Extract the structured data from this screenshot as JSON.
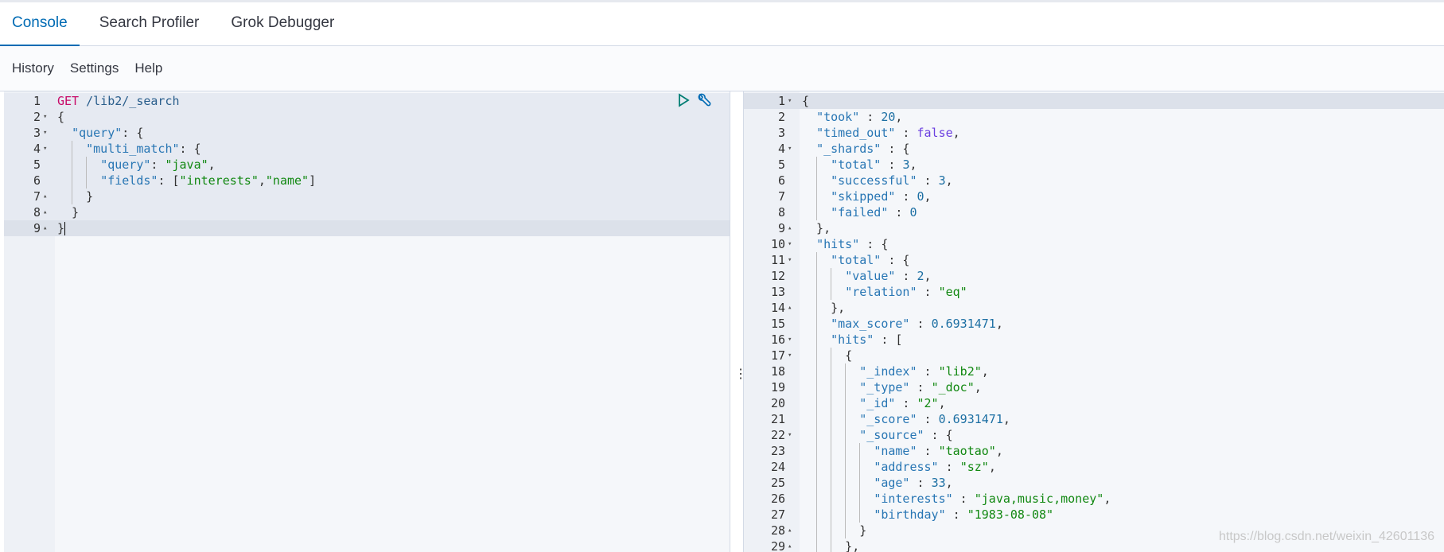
{
  "tabs": [
    {
      "label": "Console",
      "active": true
    },
    {
      "label": "Search Profiler"
    },
    {
      "label": "Grok Debugger"
    }
  ],
  "menu": [
    "History",
    "Settings",
    "Help"
  ],
  "colors": {
    "accent": "#006bb4",
    "key": "#2876b4",
    "string": "#118811",
    "number": "#1c6fa3",
    "boolean": "#6b3fe0",
    "method": "#c80a68"
  },
  "actions": {
    "run": "play-icon",
    "settings": "wrench-icon"
  },
  "divider_icon": "⋮",
  "watermark": "https://blog.csdn.net/weixin_42601136",
  "request": [
    {
      "n": "1",
      "f": "",
      "t": [
        [
          "m",
          "GET"
        ],
        [
          "p",
          " "
        ],
        [
          "url",
          "/lib2/_search"
        ]
      ]
    },
    {
      "n": "2",
      "f": "▾",
      "t": [
        [
          "p",
          "{"
        ]
      ]
    },
    {
      "n": "3",
      "f": "▾",
      "t": [
        [
          "p",
          "  "
        ],
        [
          "key",
          "\"query\""
        ],
        [
          "p",
          ": {"
        ]
      ]
    },
    {
      "n": "4",
      "f": "▾",
      "t": [
        [
          "p",
          "    "
        ],
        [
          "key",
          "\"multi_match\""
        ],
        [
          "p",
          ": {"
        ]
      ]
    },
    {
      "n": "5",
      "f": "",
      "t": [
        [
          "p",
          "      "
        ],
        [
          "key",
          "\"query\""
        ],
        [
          "p",
          ": "
        ],
        [
          "str",
          "\"java\""
        ],
        [
          "p",
          ","
        ]
      ]
    },
    {
      "n": "6",
      "f": "",
      "t": [
        [
          "p",
          "      "
        ],
        [
          "key",
          "\"fields\""
        ],
        [
          "p",
          ": ["
        ],
        [
          "str",
          "\"interests\""
        ],
        [
          "p",
          ","
        ],
        [
          "str",
          "\"name\""
        ],
        [
          "p",
          "]"
        ]
      ]
    },
    {
      "n": "7",
      "f": "▴",
      "t": [
        [
          "p",
          "    }"
        ]
      ]
    },
    {
      "n": "8",
      "f": "▴",
      "t": [
        [
          "p",
          "  }"
        ]
      ]
    },
    {
      "n": "9",
      "f": "▴",
      "t": [
        [
          "p",
          "}"
        ]
      ]
    }
  ],
  "response": [
    {
      "n": "1",
      "f": "▾",
      "t": [
        [
          "p",
          "{"
        ]
      ]
    },
    {
      "n": "2",
      "f": "",
      "t": [
        [
          "p",
          "  "
        ],
        [
          "key",
          "\"took\""
        ],
        [
          "p",
          " : "
        ],
        [
          "num",
          "20"
        ],
        [
          "p",
          ","
        ]
      ]
    },
    {
      "n": "3",
      "f": "",
      "t": [
        [
          "p",
          "  "
        ],
        [
          "key",
          "\"timed_out\""
        ],
        [
          "p",
          " : "
        ],
        [
          "bool",
          "false"
        ],
        [
          "p",
          ","
        ]
      ]
    },
    {
      "n": "4",
      "f": "▾",
      "t": [
        [
          "p",
          "  "
        ],
        [
          "key",
          "\"_shards\""
        ],
        [
          "p",
          " : {"
        ]
      ]
    },
    {
      "n": "5",
      "f": "",
      "t": [
        [
          "p",
          "    "
        ],
        [
          "key",
          "\"total\""
        ],
        [
          "p",
          " : "
        ],
        [
          "num",
          "3"
        ],
        [
          "p",
          ","
        ]
      ]
    },
    {
      "n": "6",
      "f": "",
      "t": [
        [
          "p",
          "    "
        ],
        [
          "key",
          "\"successful\""
        ],
        [
          "p",
          " : "
        ],
        [
          "num",
          "3"
        ],
        [
          "p",
          ","
        ]
      ]
    },
    {
      "n": "7",
      "f": "",
      "t": [
        [
          "p",
          "    "
        ],
        [
          "key",
          "\"skipped\""
        ],
        [
          "p",
          " : "
        ],
        [
          "num",
          "0"
        ],
        [
          "p",
          ","
        ]
      ]
    },
    {
      "n": "8",
      "f": "",
      "t": [
        [
          "p",
          "    "
        ],
        [
          "key",
          "\"failed\""
        ],
        [
          "p",
          " : "
        ],
        [
          "num",
          "0"
        ]
      ]
    },
    {
      "n": "9",
      "f": "▴",
      "t": [
        [
          "p",
          "  },"
        ]
      ]
    },
    {
      "n": "10",
      "f": "▾",
      "t": [
        [
          "p",
          "  "
        ],
        [
          "key",
          "\"hits\""
        ],
        [
          "p",
          " : {"
        ]
      ]
    },
    {
      "n": "11",
      "f": "▾",
      "t": [
        [
          "p",
          "    "
        ],
        [
          "key",
          "\"total\""
        ],
        [
          "p",
          " : {"
        ]
      ]
    },
    {
      "n": "12",
      "f": "",
      "t": [
        [
          "p",
          "      "
        ],
        [
          "key",
          "\"value\""
        ],
        [
          "p",
          " : "
        ],
        [
          "num",
          "2"
        ],
        [
          "p",
          ","
        ]
      ]
    },
    {
      "n": "13",
      "f": "",
      "t": [
        [
          "p",
          "      "
        ],
        [
          "key",
          "\"relation\""
        ],
        [
          "p",
          " : "
        ],
        [
          "str",
          "\"eq\""
        ]
      ]
    },
    {
      "n": "14",
      "f": "▴",
      "t": [
        [
          "p",
          "    },"
        ]
      ]
    },
    {
      "n": "15",
      "f": "",
      "t": [
        [
          "p",
          "    "
        ],
        [
          "key",
          "\"max_score\""
        ],
        [
          "p",
          " : "
        ],
        [
          "num",
          "0.6931471"
        ],
        [
          "p",
          ","
        ]
      ]
    },
    {
      "n": "16",
      "f": "▾",
      "t": [
        [
          "p",
          "    "
        ],
        [
          "key",
          "\"hits\""
        ],
        [
          "p",
          " : ["
        ]
      ]
    },
    {
      "n": "17",
      "f": "▾",
      "t": [
        [
          "p",
          "      {"
        ]
      ]
    },
    {
      "n": "18",
      "f": "",
      "t": [
        [
          "p",
          "        "
        ],
        [
          "key",
          "\"_index\""
        ],
        [
          "p",
          " : "
        ],
        [
          "str",
          "\"lib2\""
        ],
        [
          "p",
          ","
        ]
      ]
    },
    {
      "n": "19",
      "f": "",
      "t": [
        [
          "p",
          "        "
        ],
        [
          "key",
          "\"_type\""
        ],
        [
          "p",
          " : "
        ],
        [
          "str",
          "\"_doc\""
        ],
        [
          "p",
          ","
        ]
      ]
    },
    {
      "n": "20",
      "f": "",
      "t": [
        [
          "p",
          "        "
        ],
        [
          "key",
          "\"_id\""
        ],
        [
          "p",
          " : "
        ],
        [
          "str",
          "\"2\""
        ],
        [
          "p",
          ","
        ]
      ]
    },
    {
      "n": "21",
      "f": "",
      "t": [
        [
          "p",
          "        "
        ],
        [
          "key",
          "\"_score\""
        ],
        [
          "p",
          " : "
        ],
        [
          "num",
          "0.6931471"
        ],
        [
          "p",
          ","
        ]
      ]
    },
    {
      "n": "22",
      "f": "▾",
      "t": [
        [
          "p",
          "        "
        ],
        [
          "key",
          "\"_source\""
        ],
        [
          "p",
          " : {"
        ]
      ]
    },
    {
      "n": "23",
      "f": "",
      "t": [
        [
          "p",
          "          "
        ],
        [
          "key",
          "\"name\""
        ],
        [
          "p",
          " : "
        ],
        [
          "str",
          "\"taotao\""
        ],
        [
          "p",
          ","
        ]
      ]
    },
    {
      "n": "24",
      "f": "",
      "t": [
        [
          "p",
          "          "
        ],
        [
          "key",
          "\"address\""
        ],
        [
          "p",
          " : "
        ],
        [
          "str",
          "\"sz\""
        ],
        [
          "p",
          ","
        ]
      ]
    },
    {
      "n": "25",
      "f": "",
      "t": [
        [
          "p",
          "          "
        ],
        [
          "key",
          "\"age\""
        ],
        [
          "p",
          " : "
        ],
        [
          "num",
          "33"
        ],
        [
          "p",
          ","
        ]
      ]
    },
    {
      "n": "26",
      "f": "",
      "t": [
        [
          "p",
          "          "
        ],
        [
          "key",
          "\"interests\""
        ],
        [
          "p",
          " : "
        ],
        [
          "str",
          "\"java,music,money\""
        ],
        [
          "p",
          ","
        ]
      ]
    },
    {
      "n": "27",
      "f": "",
      "t": [
        [
          "p",
          "          "
        ],
        [
          "key",
          "\"birthday\""
        ],
        [
          "p",
          " : "
        ],
        [
          "str",
          "\"1983-08-08\""
        ]
      ]
    },
    {
      "n": "28",
      "f": "▴",
      "t": [
        [
          "p",
          "        }"
        ]
      ]
    },
    {
      "n": "29",
      "f": "▴",
      "t": [
        [
          "p",
          "      },"
        ]
      ]
    }
  ]
}
